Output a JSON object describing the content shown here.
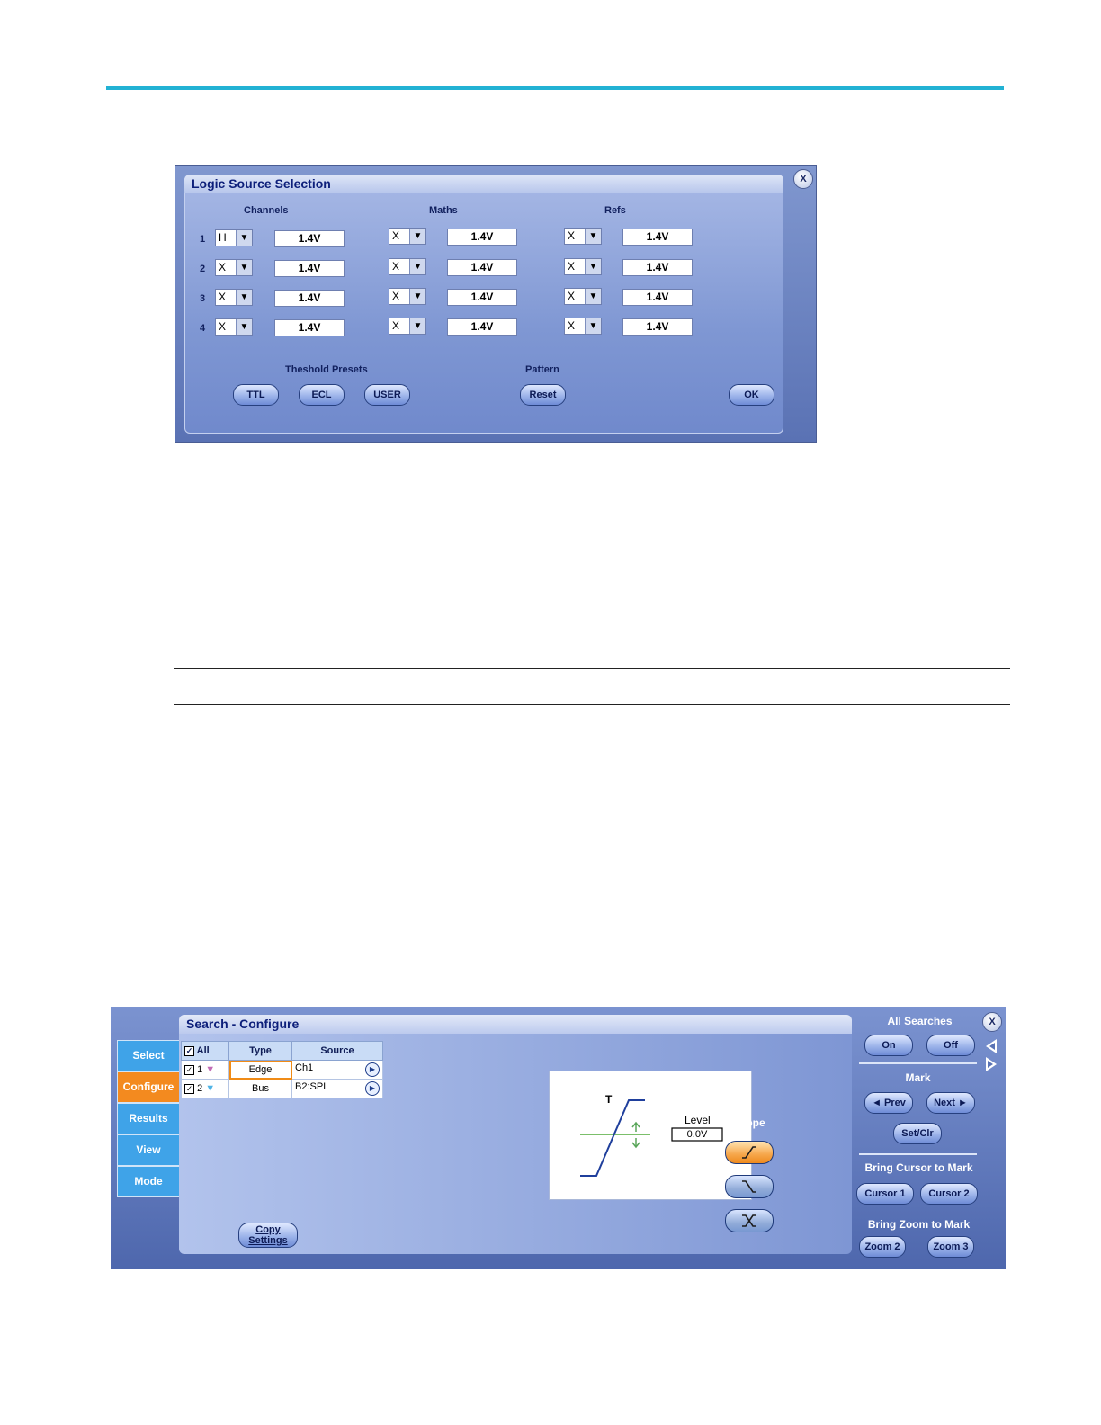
{
  "logic_dialog": {
    "title": "Logic Source Selection",
    "close_label": "X",
    "columns": {
      "channels": "Channels",
      "maths": "Maths",
      "refs": "Refs"
    },
    "rows": [
      {
        "num": "1",
        "channel": {
          "state": "H",
          "threshold": "1.4V"
        },
        "math": {
          "state": "X",
          "threshold": "1.4V"
        },
        "ref": {
          "state": "X",
          "threshold": "1.4V"
        }
      },
      {
        "num": "2",
        "channel": {
          "state": "X",
          "threshold": "1.4V"
        },
        "math": {
          "state": "X",
          "threshold": "1.4V"
        },
        "ref": {
          "state": "X",
          "threshold": "1.4V"
        }
      },
      {
        "num": "3",
        "channel": {
          "state": "X",
          "threshold": "1.4V"
        },
        "math": {
          "state": "X",
          "threshold": "1.4V"
        },
        "ref": {
          "state": "X",
          "threshold": "1.4V"
        }
      },
      {
        "num": "4",
        "channel": {
          "state": "X",
          "threshold": "1.4V"
        },
        "math": {
          "state": "X",
          "threshold": "1.4V"
        },
        "ref": {
          "state": "X",
          "threshold": "1.4V"
        }
      }
    ],
    "dropdown_glyph": "▼",
    "threshold_presets_label": "Theshold Presets",
    "presets": [
      "TTL",
      "ECL",
      "USER"
    ],
    "pattern_label": "Pattern",
    "reset_label": "Reset",
    "ok_label": "OK"
  },
  "search_dialog": {
    "title": "Search - Configure",
    "nav": [
      "Select",
      "Configure",
      "Results",
      "View",
      "Mode"
    ],
    "active_nav": "Configure",
    "table": {
      "headers": {
        "all": "All",
        "type": "Type",
        "source": "Source"
      },
      "rows": [
        {
          "num": "1",
          "checked": "✓",
          "marker": "▼",
          "marker_color": "#c26bb5",
          "type": "Edge",
          "source": "Ch1"
        },
        {
          "num": "2",
          "checked": "✓",
          "marker": "▼",
          "marker_color": "#4fb4e6",
          "type": "Bus",
          "source": "B2:SPI"
        }
      ]
    },
    "graph": {
      "level_label": "Level",
      "level_value": "0.0V",
      "trigger_marker": "T"
    },
    "slope_label": "Slope",
    "copy_settings_label": [
      "Copy",
      "Settings"
    ],
    "right_panel": {
      "all_searches_label": "All Searches",
      "on_label": "On",
      "off_label": "Off",
      "mark_label": "Mark",
      "prev_label": "◄ Prev",
      "next_label": "Next ►",
      "setclr_label": "Set/Clr",
      "bring_cursor_label": "Bring Cursor to Mark",
      "cursor1_label": "Cursor 1",
      "cursor2_label": "Cursor 2",
      "bring_zoom_label": "Bring Zoom to Mark",
      "zoom2_label": "Zoom 2",
      "zoom3_label": "Zoom 3",
      "close_label": "X"
    },
    "colors": {
      "active_nav": "#f38a1f",
      "nav": "#3fa3e8",
      "slope_active": "#f6a64a"
    }
  }
}
